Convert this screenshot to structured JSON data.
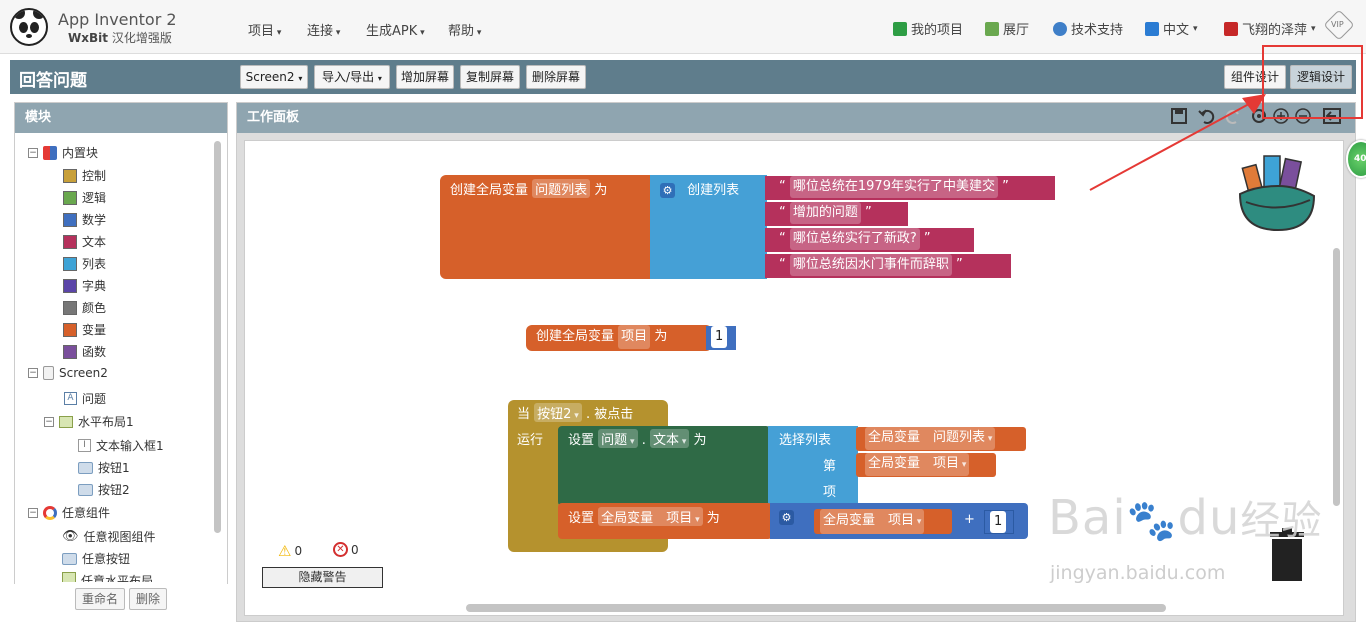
{
  "brand": {
    "title": "App Inventor 2",
    "sub_bold": "WxBit",
    "sub_rest": "汉化增强版"
  },
  "menus": [
    "项目",
    "连接",
    "生成APK",
    "帮助"
  ],
  "nav_right": {
    "my_projects": "我的项目",
    "gallery": "展厅",
    "support": "技术支持",
    "language": "中文",
    "user": "飞翔的泽萍",
    "vip": "VIP"
  },
  "titlebar": {
    "screen_title": "回答问题",
    "screen_select": "Screen2",
    "import_export": "导入/导出",
    "add_screen": "增加屏幕",
    "copy_screen": "复制屏幕",
    "delete_screen": "删除屏幕",
    "designer": "组件设计",
    "blocks": "逻辑设计"
  },
  "blocks_panel": {
    "header": "模块",
    "builtin": "内置块",
    "builtin_items": [
      {
        "label": "控制",
        "color": "#c8a03a"
      },
      {
        "label": "逻辑",
        "color": "#6aa84f"
      },
      {
        "label": "数学",
        "color": "#3f6fbf"
      },
      {
        "label": "文本",
        "color": "#b5315c"
      },
      {
        "label": "列表",
        "color": "#3ea3d6"
      },
      {
        "label": "字典",
        "color": "#5b45a8"
      },
      {
        "label": "颜色",
        "color": "#777777"
      },
      {
        "label": "变量",
        "color": "#d6602a"
      },
      {
        "label": "函数",
        "color": "#7a4f9c"
      }
    ],
    "screen": "Screen2",
    "question": "问题",
    "hlayout": "水平布局1",
    "textbox": "文本输入框1",
    "button1": "按钮1",
    "button2": "按钮2",
    "any_component": "任意组件",
    "any_viewer": "任意视图组件",
    "any_button": "任意按钮",
    "any_hlayout": "任意水平布局",
    "rename": "重命名",
    "delete": "删除"
  },
  "workspace": {
    "header": "工作面板",
    "warnings_count": "0",
    "errors_count": "0",
    "hide_warnings": "隐藏警告"
  },
  "code": {
    "init_global": "创建全局变量",
    "as": "为",
    "var_questions": "问题列表",
    "make_list": "创建列表",
    "q1": "哪位总统在1979年实行了中美建交",
    "q2": "增加的问题",
    "q3": "哪位总统实行了新政?",
    "q4": "哪位总统因水门事件而辞职",
    "var_index": "项目",
    "index_value": "1",
    "when": "当",
    "button": "按钮2",
    "click": ". 被点击",
    "do": "运行",
    "set": "设置",
    "label_component": "问题",
    "dot": ".",
    "text_prop": "文本",
    "select_list_item": "选择列表",
    "nth": "第",
    "item": "项",
    "global": "全局变量",
    "plus": "+",
    "one": "1"
  },
  "watermark": {
    "line1": "Bai",
    "line2": "du",
    "line3": "经验",
    "url": "jingyan.baidu.com"
  },
  "colors": {
    "variable": "#d6602a",
    "list": "#45a0d6",
    "text": "#b5315c",
    "math": "#3f6fbf",
    "control": "#b5922e",
    "component": "#2f6a46",
    "highlight": "#e53935"
  },
  "side_badge": "40"
}
